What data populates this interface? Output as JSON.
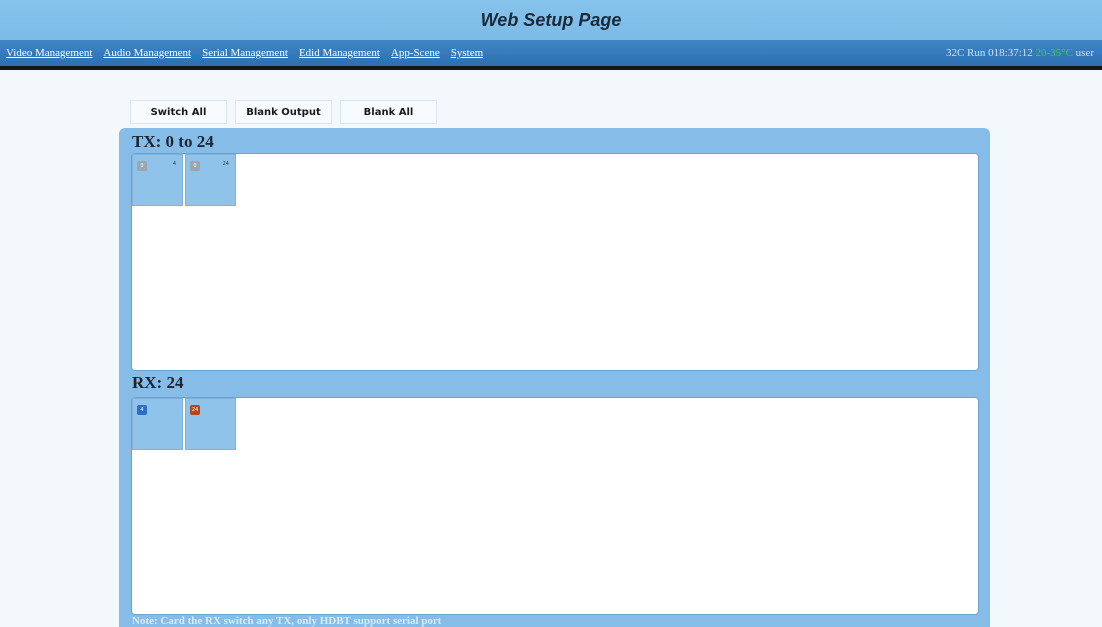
{
  "header": {
    "title": "Web Setup Page"
  },
  "nav": {
    "links": [
      "Video Management",
      "Audio Management",
      "Serial Management",
      "Edid Management",
      "App-Scene",
      "System"
    ],
    "status": {
      "temp_c": "32C",
      "run_label": "Run",
      "run_time": "018:37:12",
      "temp_range": "20-35°C",
      "user": "user"
    }
  },
  "actions": {
    "switch_all": "Switch All",
    "blank_output": "Blank Output",
    "blank_all": "Blank All"
  },
  "tx": {
    "title": "TX: 0 to 24",
    "cards": [
      {
        "badge": "0",
        "number": "4",
        "badge_color": "gray"
      },
      {
        "badge": "0",
        "number": "24",
        "badge_color": "gray"
      }
    ]
  },
  "rx": {
    "title": "RX: 24",
    "cards": [
      {
        "badge": "4",
        "badge_color": "blue"
      },
      {
        "badge": "24",
        "badge_color": "rust"
      }
    ]
  },
  "note": "Note: Card the RX switch any TX, only HDBT support serial port"
}
